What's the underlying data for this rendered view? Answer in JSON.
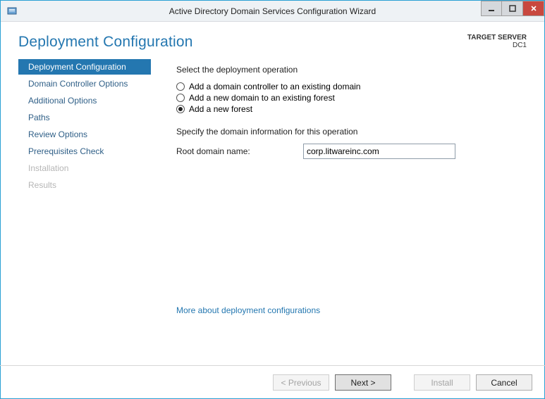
{
  "window": {
    "title": "Active Directory Domain Services Configuration Wizard",
    "icon": "server-wizard-icon"
  },
  "header": {
    "page_title": "Deployment Configuration",
    "target_server_label": "TARGET SERVER",
    "target_server_value": "DC1"
  },
  "sidebar": {
    "items": [
      {
        "label": "Deployment Configuration",
        "active": true,
        "enabled": true
      },
      {
        "label": "Domain Controller Options",
        "active": false,
        "enabled": true
      },
      {
        "label": "Additional Options",
        "active": false,
        "enabled": true
      },
      {
        "label": "Paths",
        "active": false,
        "enabled": true
      },
      {
        "label": "Review Options",
        "active": false,
        "enabled": true
      },
      {
        "label": "Prerequisites Check",
        "active": false,
        "enabled": true
      },
      {
        "label": "Installation",
        "active": false,
        "enabled": false
      },
      {
        "label": "Results",
        "active": false,
        "enabled": false
      }
    ]
  },
  "main": {
    "select_op_label": "Select the deployment operation",
    "radios": [
      {
        "label": "Add a domain controller to an existing domain",
        "checked": false
      },
      {
        "label": "Add a new domain to an existing forest",
        "checked": false
      },
      {
        "label": "Add a new forest",
        "checked": true
      }
    ],
    "specify_label": "Specify the domain information for this operation",
    "root_domain_label": "Root domain name:",
    "root_domain_value": "corp.litwareinc.com",
    "help_link": "More about deployment configurations"
  },
  "footer": {
    "previous": "< Previous",
    "next": "Next >",
    "install": "Install",
    "cancel": "Cancel",
    "previous_enabled": false,
    "next_enabled": true,
    "install_enabled": false,
    "cancel_enabled": true
  }
}
